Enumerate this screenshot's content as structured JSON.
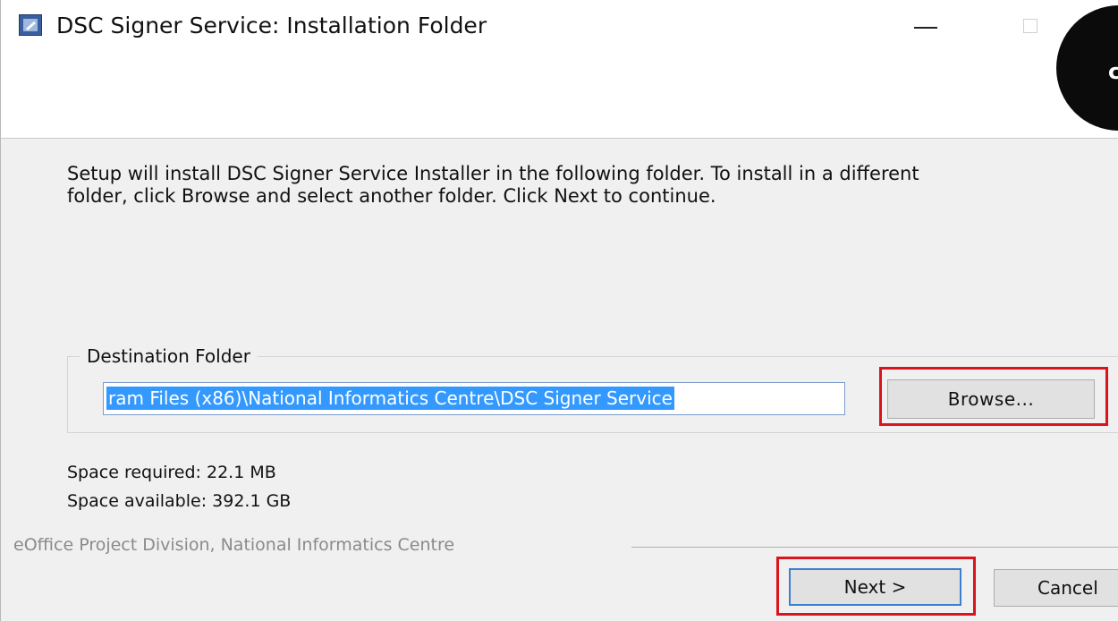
{
  "window": {
    "title": "DSC Signer Service: Installation Folder",
    "overlay_letter": "c"
  },
  "description": {
    "line1": "Setup will install DSC Signer Service Installer in the following folder. To install in a different",
    "line2": "folder, click Browse and select another folder. Click Next to continue."
  },
  "destination": {
    "group_label": "Destination Folder",
    "path_value": "ram Files (x86)\\National Informatics Centre\\DSC Signer Service",
    "browse_label": "Browse..."
  },
  "space": {
    "required": "Space required: 22.1 MB",
    "available": "Space available: 392.1 GB"
  },
  "footer": {
    "branding": "eOffice Project Division, National Informatics Centre",
    "next_label": "Next >",
    "cancel_label": "Cancel"
  },
  "colors": {
    "highlight": "#d9141c",
    "selection": "#3399ff",
    "focus_border": "#3c7fd1"
  }
}
